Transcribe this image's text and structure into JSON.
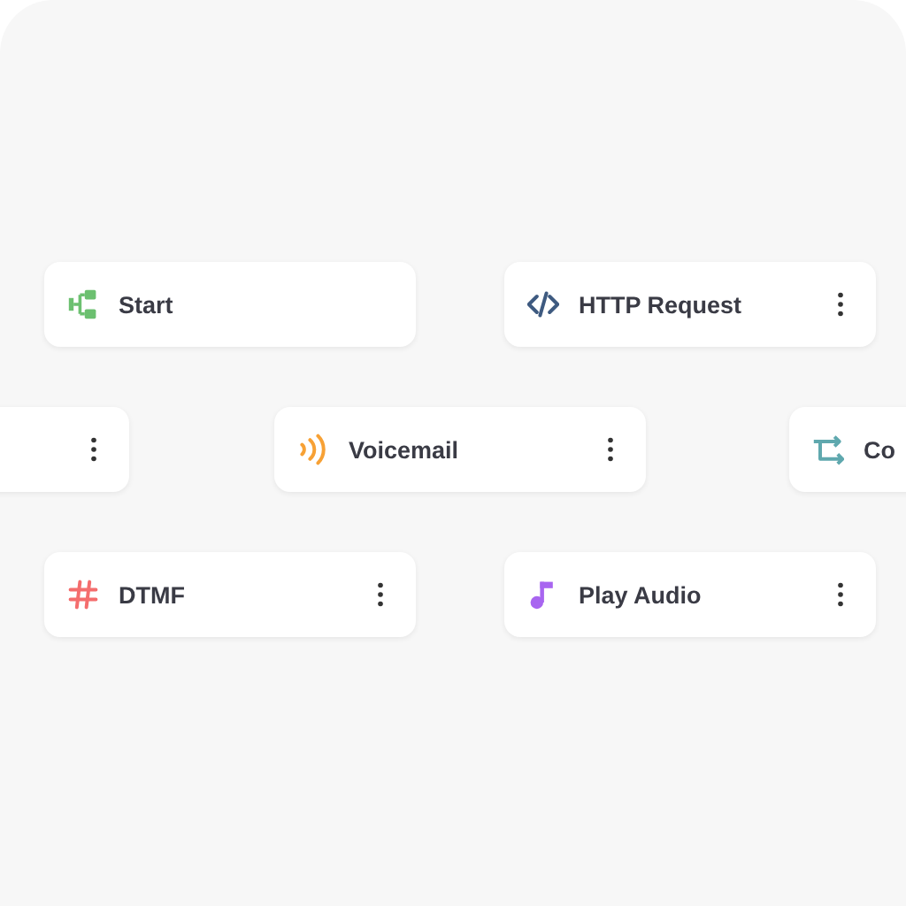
{
  "nodes": [
    {
      "kind": "start",
      "label": "Start",
      "color": "#6cc070",
      "menu": false
    },
    {
      "kind": "code",
      "label": "HTTP Request",
      "color": "#3e5a80",
      "menu": true
    },
    {
      "kind": "none",
      "menu": true
    },
    {
      "kind": "voicemail",
      "label": "Voicemail",
      "color": "#f7a135",
      "menu": true
    },
    {
      "kind": "switch",
      "label": "Co",
      "color": "#5fa8ae",
      "menu": false
    },
    {
      "kind": "hash",
      "label": "DTMF",
      "color": "#f46d6d",
      "menu": true
    },
    {
      "kind": "music",
      "label": "Play Audio",
      "color": "#a865f0",
      "menu": true
    }
  ]
}
